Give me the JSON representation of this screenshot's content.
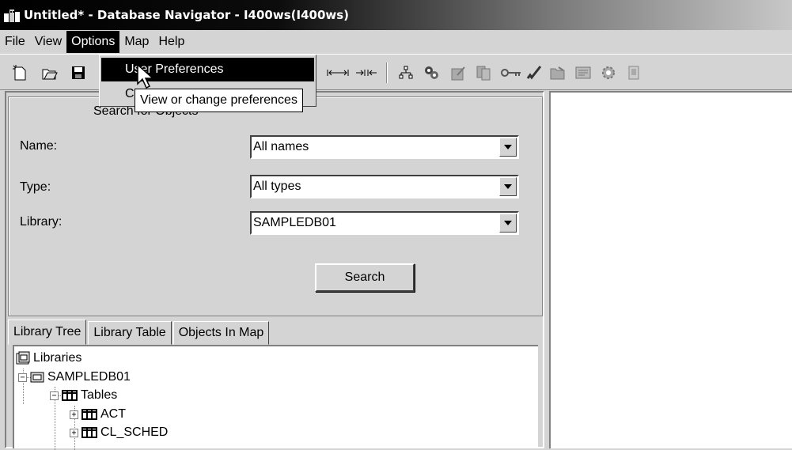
{
  "window": {
    "title": "Untitled* - Database Navigator - I400ws(I400ws)"
  },
  "menubar": {
    "file": "File",
    "view": "View",
    "options": "Options",
    "map": "Map",
    "help": "Help"
  },
  "options_menu": {
    "items": [
      {
        "label": "User Preferences"
      },
      {
        "label": "C"
      }
    ],
    "tooltip": "View or change preferences"
  },
  "search": {
    "title": "Search for Objects",
    "name_label": "Name:",
    "name_value": "All names",
    "type_label": "Type:",
    "type_value": "All types",
    "library_label": "Library:",
    "library_value": "SAMPLEDB01",
    "button": "Search"
  },
  "tabs": [
    {
      "label": "Library Tree"
    },
    {
      "label": "Library Table"
    },
    {
      "label": "Objects In Map"
    }
  ],
  "tree": {
    "root": "Libraries",
    "library": "SAMPLEDB01",
    "folder": "Tables",
    "items": [
      "ACT",
      "CL_SCHED"
    ]
  },
  "icons": {
    "toolbar": [
      "new-icon",
      "open-icon",
      "save-icon",
      "expand-icon",
      "collapse-icon",
      "relationship-icon",
      "explain-icon",
      "edit-icon",
      "copy-icon",
      "key-icon",
      "check-icon",
      "folder-link-icon",
      "view-icon",
      "gear-icon",
      "document-icon"
    ]
  },
  "colors": {
    "title_bar": "#000000",
    "menu_highlight": "#000000",
    "background": "#d4d4d4"
  }
}
